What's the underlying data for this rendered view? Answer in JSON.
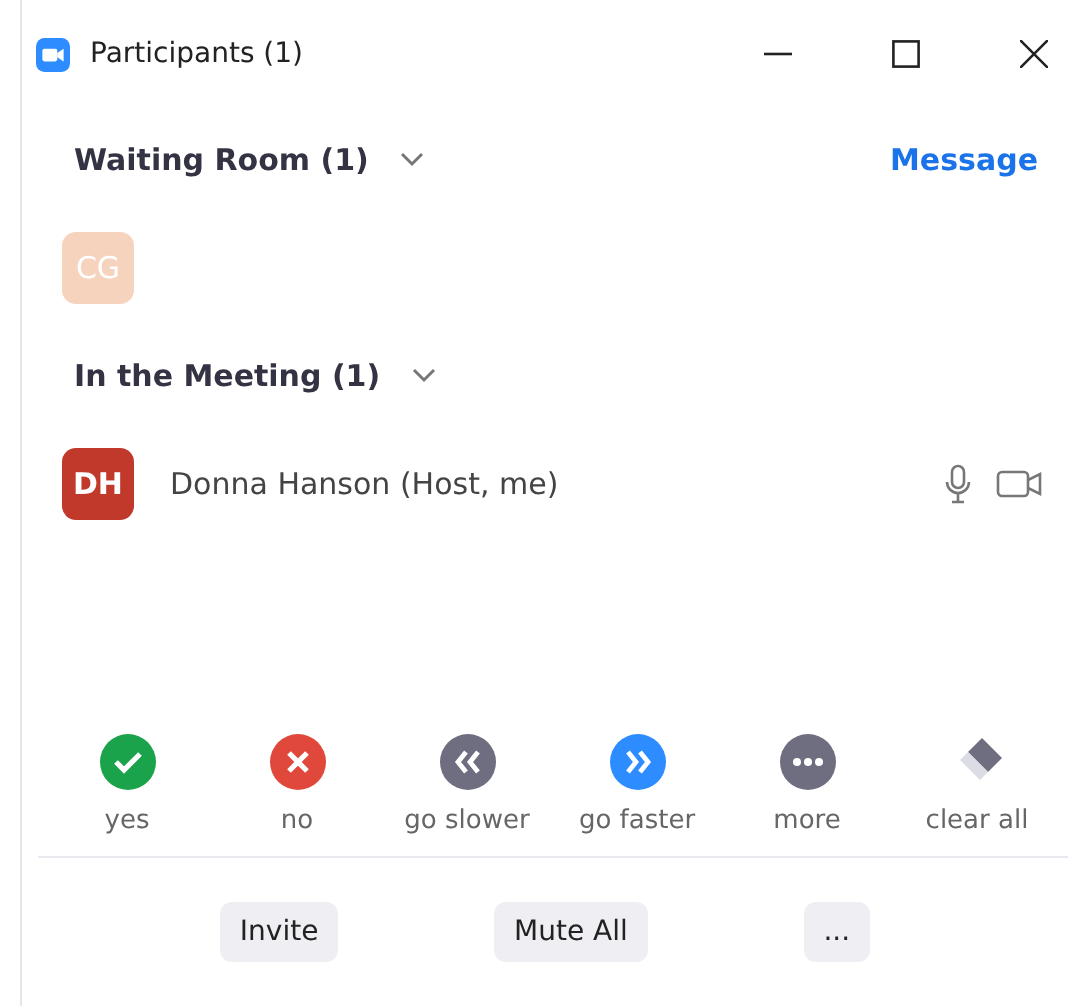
{
  "window": {
    "title": "Participants (1)"
  },
  "waiting_room": {
    "heading": "Waiting Room (1)",
    "action": "Message",
    "participants": [
      {
        "initials": "CG",
        "color": "#f6d3bd"
      }
    ]
  },
  "in_meeting": {
    "heading": "In the Meeting (1)",
    "participants": [
      {
        "initials": "DH",
        "color": "#c0392b",
        "name": "Donna Hanson (Host, me)"
      }
    ]
  },
  "feedback": [
    {
      "kind": "yes",
      "label": "yes"
    },
    {
      "kind": "no",
      "label": "no"
    },
    {
      "kind": "slower",
      "label": "go slower"
    },
    {
      "kind": "faster",
      "label": "go faster"
    },
    {
      "kind": "more",
      "label": "more"
    },
    {
      "kind": "clear",
      "label": "clear all"
    }
  ],
  "buttons": [
    "Invite",
    "Mute All",
    "..."
  ]
}
